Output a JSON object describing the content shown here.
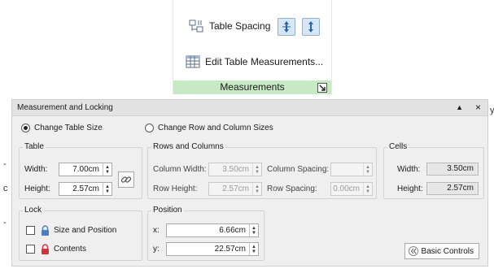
{
  "ribbon": {
    "table_spacing_label": "Table Spacing",
    "edit_measurements_label": "Edit Table Measurements...",
    "group_caption": "Measurements"
  },
  "panel": {
    "title": "Measurement and Locking",
    "collapse_glyph": "▲",
    "close_glyph": "×",
    "mode_options": {
      "table_size": "Change Table Size",
      "row_col": "Change Row and Column Sizes"
    },
    "table": {
      "title": "Table",
      "width_label": "Width:",
      "width_value": "7.00cm",
      "height_label": "Height:",
      "height_value": "2.57cm"
    },
    "rows_cols": {
      "title": "Rows and Columns",
      "col_width_label": "Column Width:",
      "col_width_value": "3.50cm",
      "row_height_label": "Row Height:",
      "row_height_value": "2.57cm",
      "col_spacing_label": "Column Spacing:",
      "col_spacing_value": "",
      "row_spacing_label": "Row Spacing:",
      "row_spacing_value": "0.00cm"
    },
    "cells": {
      "title": "Cells",
      "width_label": "Width:",
      "width_value": "3.50cm",
      "height_label": "Height:",
      "height_value": "2.57cm"
    },
    "lock": {
      "title": "Lock",
      "size_position_label": "Size and Position",
      "contents_label": "Contents"
    },
    "position": {
      "title": "Position",
      "x_label": "x:",
      "x_value": "6.66cm",
      "y_label": "y:",
      "y_value": "22.57cm"
    },
    "basic_controls_label": "Basic Controls"
  },
  "icons": {
    "table-spacing": "table-spacing-icon",
    "spacing-button-1": "vertical-spacing-icon",
    "spacing-button-2": "vertical-spacing-icon",
    "edit-measurements": "table-grid-icon",
    "dialog-launcher": "dialog-launcher-icon",
    "lock": "lock-icon",
    "link": "chain-link-icon",
    "basic-controls": "double-chevron-left-icon"
  },
  "colors": {
    "ribbon_caption_bg": "#c7e9c4",
    "lock_icon_blue": "#4a7fc1",
    "lock_icon_red": "#d2323c",
    "spin_button_bg": "#d7e6f4"
  },
  "edge_fragments": {
    "right_edge_char": "y",
    "left_edge_char_1": "-",
    "left_edge_char_2": "c",
    "left_edge_char_3": "-"
  }
}
